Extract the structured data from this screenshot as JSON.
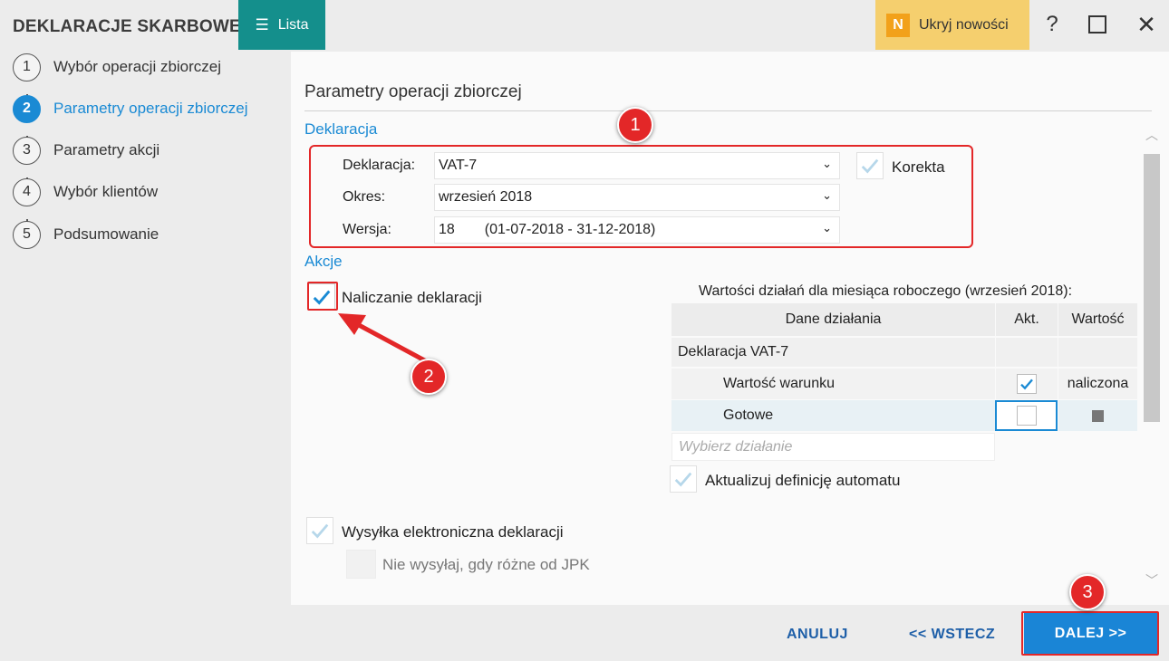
{
  "app": {
    "title": "DEKLARACJE SKARBOWE",
    "list_button": "Lista",
    "news_badge": "N",
    "news_button": "Ukryj nowości",
    "help": "?",
    "close": "✕"
  },
  "steps": [
    {
      "num": "1",
      "label": "Wybór operacji zbiorczej",
      "active": false
    },
    {
      "num": "2",
      "label": "Parametry operacji zbiorczej",
      "active": true
    },
    {
      "num": "3",
      "label": "Parametry akcji",
      "active": false
    },
    {
      "num": "4",
      "label": "Wybór klientów",
      "active": false
    },
    {
      "num": "5",
      "label": "Podsumowanie",
      "active": false
    }
  ],
  "main": {
    "title": "Parametry operacji zbiorczej",
    "declaration_section": "Deklaracja",
    "fields": {
      "deklaracja_label": "Deklaracja:",
      "deklaracja_value": "VAT-7",
      "okres_label": "Okres:",
      "okres_value": "wrzesień 2018",
      "wersja_label": "Wersja:",
      "wersja_num": "18",
      "wersja_dates": "(01-07-2018 - 31-12-2018)"
    },
    "korekta_label": "Korekta",
    "actions_section": "Akcje",
    "naliczanie_label": "Naliczanie deklaracji",
    "table": {
      "caption": "Wartości działań dla miesiąca roboczego (wrzesień 2018):",
      "headers": [
        "Dane działania",
        "Akt.",
        "Wartość"
      ],
      "group": "Deklaracja VAT-7",
      "rows": [
        {
          "name": "Wartość warunku",
          "value": "naliczona"
        },
        {
          "name": "Gotowe",
          "value": ""
        }
      ],
      "placeholder": "Wybierz działanie"
    },
    "auto_update_label": "Aktualizuj definicję automatu",
    "send_label": "Wysyłka elektroniczna deklaracji",
    "no_send_label": "Nie wysyłaj, gdy różne od JPK"
  },
  "annotations": [
    "1",
    "2",
    "3"
  ],
  "footer": {
    "cancel": "ANULUJ",
    "back": "<< WSTECZ",
    "next": "DALEJ >>"
  },
  "colors": {
    "accent": "#1a8ad4",
    "teal": "#148f8c",
    "news": "#f5cf6e",
    "annotation": "#e32728"
  }
}
